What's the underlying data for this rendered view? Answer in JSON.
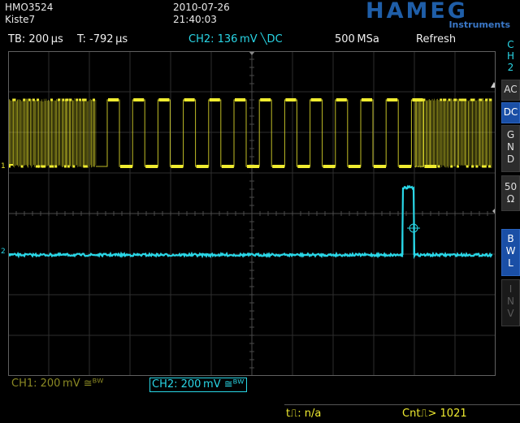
{
  "header": {
    "model": "HMO3524",
    "file": "Kiste7",
    "date": "2010-07-26",
    "time": "21:40:03",
    "brand": "HAMEG",
    "brand_sub": "Instruments",
    "brand_color": "#1f5ea8"
  },
  "status_bar": {
    "timebase": "TB: 200 µs",
    "trigger_time": "T: -792 µs",
    "channel_trigger": "CH2: 136 mV ╲DC",
    "sample_rate": "500 MSa",
    "acquisition_mode": "Refresh"
  },
  "channels": {
    "ch1": {
      "label": "CH1: 200 mV ≅ᴮᵂ",
      "color": "#f0ec30",
      "marker": "1"
    },
    "ch2": {
      "label": "CH2: 200 mV ≅ᴮᵂ",
      "color": "#29d6e6",
      "marker": "2"
    }
  },
  "soft_keys": {
    "title": "CH 2",
    "keys": [
      {
        "label": "AC",
        "active": false
      },
      {
        "label": "DC",
        "active": true
      },
      {
        "label": "G N D",
        "active": false
      },
      {
        "label": "50 Ω",
        "active": false
      },
      {
        "label": "B W L",
        "active": true
      },
      {
        "label": "I N V",
        "active": false,
        "dim": true
      }
    ]
  },
  "footer": {
    "rise_time": "t⎍: n/a",
    "counter": "Cnt⎍> 1021"
  }
}
